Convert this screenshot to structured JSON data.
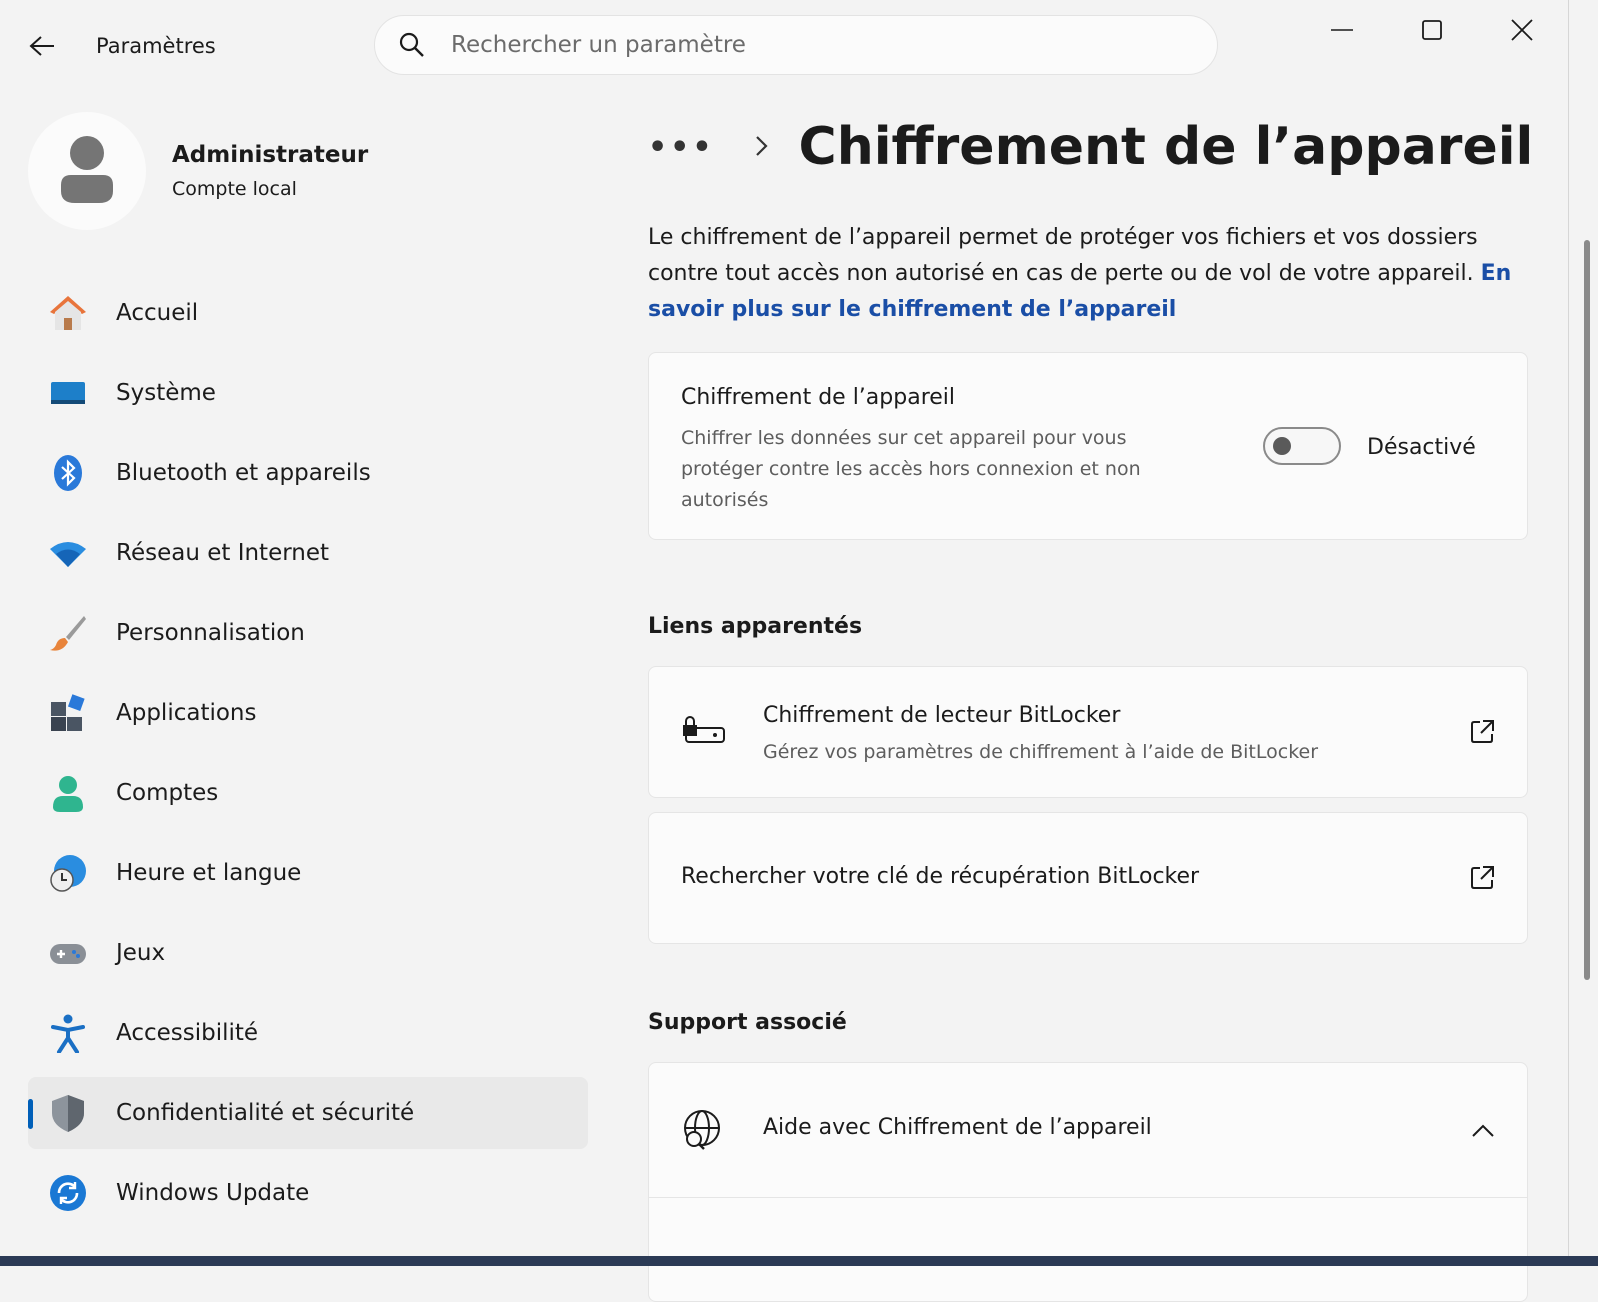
{
  "titlebar": {
    "app_title": "Paramètres",
    "search_placeholder": "Rechercher un paramètre"
  },
  "user": {
    "name": "Administrateur",
    "account_type": "Compte local"
  },
  "sidebar": {
    "items": [
      {
        "label": "Accueil",
        "icon": "home-icon"
      },
      {
        "label": "Système",
        "icon": "monitor-icon"
      },
      {
        "label": "Bluetooth et appareils",
        "icon": "bluetooth-icon"
      },
      {
        "label": "Réseau et Internet",
        "icon": "wifi-icon"
      },
      {
        "label": "Personnalisation",
        "icon": "paintbrush-icon"
      },
      {
        "label": "Applications",
        "icon": "apps-icon"
      },
      {
        "label": "Comptes",
        "icon": "person-icon"
      },
      {
        "label": "Heure et langue",
        "icon": "globe-clock-icon"
      },
      {
        "label": "Jeux",
        "icon": "gamepad-icon"
      },
      {
        "label": "Accessibilité",
        "icon": "accessibility-icon"
      },
      {
        "label": "Confidentialité et sécurité",
        "icon": "shield-icon",
        "selected": true
      },
      {
        "label": "Windows Update",
        "icon": "update-icon"
      }
    ]
  },
  "main": {
    "breadcrumb_more": "•••",
    "page_title": "Chiffrement de l’appareil",
    "description": "Le chiffrement de l’appareil permet de protéger vos fichiers et vos dossiers contre tout accès non autorisé en cas de perte ou de vol de votre appareil.",
    "learn_more_link": "En savoir plus sur le chiffrement de l’appareil",
    "encryption_card": {
      "title": "Chiffrement de l’appareil",
      "description": "Chiffrer les données sur cet appareil pour vous protéger contre les accès hors connexion et non autorisés",
      "toggle_state": "Désactivé",
      "toggle_on": false
    },
    "related_links_heading": "Liens apparentés",
    "related_links": [
      {
        "title": "Chiffrement de lecteur BitLocker",
        "subtitle": "Gérez vos paramètres de chiffrement à l’aide de BitLocker"
      },
      {
        "title": "Rechercher votre clé de récupération BitLocker"
      }
    ],
    "support_heading": "Support associé",
    "help_item": "Aide avec Chiffrement de l’appareil"
  },
  "colors": {
    "accent": "#005fb8",
    "link": "#1a4ea6",
    "background": "#f3f3f3",
    "card": "#fbfbfb"
  }
}
